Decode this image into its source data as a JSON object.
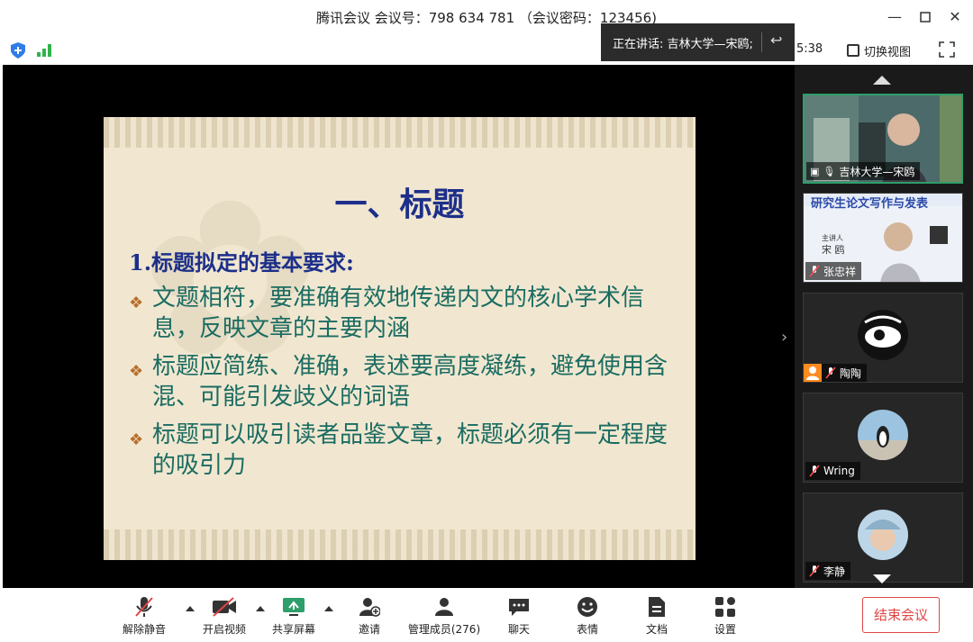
{
  "window": {
    "title": "腾讯会议 会议号：798 634 781 （会议密码：123456)"
  },
  "infobar": {
    "speaking_label": "正在讲话: 吉林大学—宋鸥;",
    "timer": "5:38",
    "switch_view_label": "切换视图"
  },
  "slide": {
    "title": "一、标题",
    "subtitle": "1.标题拟定的基本要求:",
    "bullets": [
      "文题相符，要准确有效地传递内文的核心学术信息，反映文章的主要内涵",
      "标题应简练、准确，表述要高度凝练，避免使用含混、可能引发歧义的词语",
      "标题可以吸引读者品鉴文章，标题必须有一定程度的吸引力"
    ]
  },
  "participants": [
    {
      "name": "吉林大学—宋鸥",
      "active": true
    },
    {
      "name": "张忠祥",
      "overlay_title": "研究生论文写作与发表"
    },
    {
      "name": "陶陶"
    },
    {
      "name": "Wring"
    },
    {
      "name": "李静"
    }
  ],
  "toolbar": {
    "mute": "解除静音",
    "video": "开启视频",
    "share": "共享屏幕",
    "invite": "邀请",
    "members": "管理成员(276)",
    "chat": "聊天",
    "reactions": "表情",
    "docs": "文档",
    "settings": "设置",
    "end": "结束会议"
  },
  "colors": {
    "accent_green": "#2e9e6a",
    "end_red": "#e04545",
    "slide_title_blue": "#1c2f8a",
    "slide_text_teal": "#1a6c62"
  }
}
